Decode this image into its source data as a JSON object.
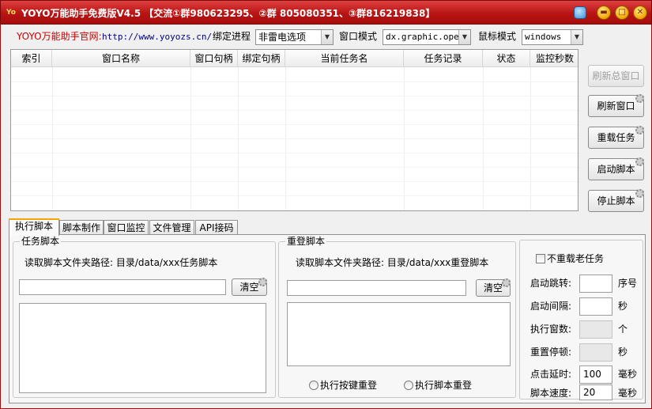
{
  "window": {
    "app_icon_text": "Yo",
    "title": "YOYO万能助手免费版V4.5   【交流①群980623295、②群 805080351、③群816219838】"
  },
  "toolbar": {
    "site_label": "YOYO万能助手官网:",
    "site_url": "http://www.yoyozs.cn/",
    "bind_process_label": "绑定进程",
    "bind_process_value": "非雷电选项",
    "window_mode_label": "窗口模式",
    "window_mode_value": "dx.graphic.open",
    "mouse_mode_label": "鼠标模式",
    "mouse_mode_value": "windows"
  },
  "table": {
    "columns": [
      "索引",
      "窗口名称",
      "窗口句柄",
      "绑定句柄",
      "当前任务名",
      "任务记录",
      "状态",
      "监控秒数"
    ],
    "rows": []
  },
  "side_buttons": {
    "refresh_all": "刷新总窗口",
    "refresh_window": "刷新窗口",
    "reload_task": "重载任务",
    "start_script": "启动脚本",
    "stop_script": "停止脚本"
  },
  "tabs": [
    "执行脚本",
    "脚本制作",
    "窗口监控",
    "文件管理",
    "API接码"
  ],
  "task_script": {
    "group_title": "任务脚本",
    "path_label": "读取脚本文件夹路径: 目录/data/xxx任务脚本",
    "path_value": "",
    "clear_label": "清空"
  },
  "relogin_script": {
    "group_title": "重登脚本",
    "path_label": "读取脚本文件夹路径: 目录/data/xxx重登脚本",
    "path_value": "",
    "clear_label": "清空",
    "radio_key_relogin": "执行按键重登",
    "radio_script_relogin": "执行脚本重登"
  },
  "settings": {
    "no_reload_old_task": "不重载老任务",
    "start_jump_label": "启动跳转:",
    "start_jump_value": "",
    "start_jump_unit": "序号",
    "start_interval_label": "启动间隔:",
    "start_interval_value": "",
    "start_interval_unit": "秒",
    "exec_windows_label": "执行窗数:",
    "exec_windows_value": "",
    "exec_windows_unit": "个",
    "reset_pause_label": "重置停顿:",
    "reset_pause_value": "",
    "reset_pause_unit": "秒",
    "click_delay_label": "点击延时:",
    "click_delay_value": "100",
    "click_delay_unit": "毫秒",
    "script_speed_label": "脚本速度:",
    "script_speed_value": "20",
    "script_speed_unit": "毫秒"
  }
}
